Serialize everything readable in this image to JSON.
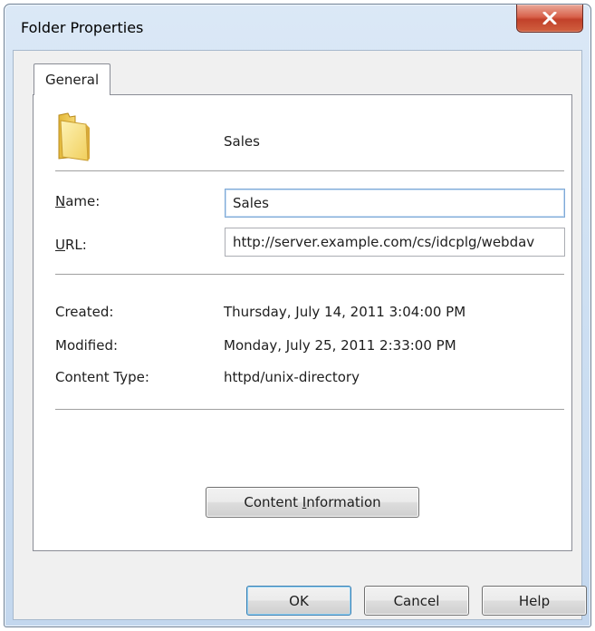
{
  "window": {
    "title": "Folder Properties"
  },
  "tabs": [
    {
      "label": "General",
      "selected": true
    }
  ],
  "general": {
    "folder_display_name": "Sales",
    "fields": {
      "name": {
        "label_accel": "N",
        "label_rest": "ame:",
        "value": "Sales"
      },
      "url": {
        "label_accel": "U",
        "label_rest": "RL:",
        "value": "http://server.example.com/cs/idcplg/webdav"
      }
    },
    "info": [
      {
        "label": "Created:",
        "value": "Thursday, July 14, 2011 3:04:00 PM"
      },
      {
        "label": "Modified:",
        "value": "Monday, July 25, 2011 2:33:00 PM"
      },
      {
        "label": "Content Type:",
        "value": "httpd/unix-directory"
      }
    ],
    "content_info_button": {
      "before": "Content ",
      "accel": "I",
      "after": "nformation"
    }
  },
  "footer": {
    "ok": "OK",
    "cancel": "Cancel",
    "help": "Help"
  },
  "icons": {
    "folder": "folder-icon",
    "close": "close-icon"
  },
  "colors": {
    "close_button": "#c7462e",
    "title_gradient_top": "#dbe8f6",
    "client_background": "#f0f0f0",
    "focused_border": "#7fa9d6"
  }
}
